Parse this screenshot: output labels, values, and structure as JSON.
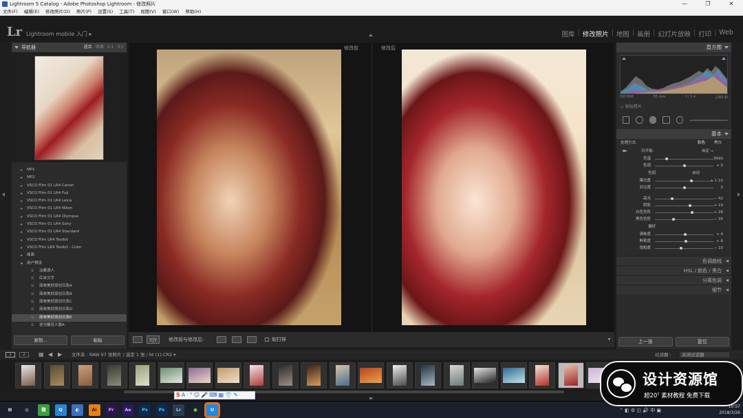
{
  "window": {
    "title": "Lightroom 5 Catalog - Adobe Photoshop Lightroom - 修改照片",
    "controls": [
      "—",
      "❐",
      "✕"
    ]
  },
  "menu": [
    "文件(F)",
    "编辑(E)",
    "修改照片(D)",
    "照片(P)",
    "设置(S)",
    "工具(T)",
    "视图(V)",
    "窗口(W)",
    "帮助(H)"
  ],
  "identity": {
    "logo": "Lr",
    "mobile": "Lightroom mobile 入门",
    "arrow": "▸"
  },
  "modules": [
    {
      "label": "图库",
      "active": false
    },
    {
      "label": "修改照片",
      "active": true
    },
    {
      "label": "地图",
      "active": false
    },
    {
      "label": "画册",
      "active": false
    },
    {
      "label": "幻灯片放映",
      "active": false
    },
    {
      "label": "打印",
      "active": false
    },
    {
      "label": "Web",
      "active": false
    }
  ],
  "navigator": {
    "title": "导航器",
    "options": [
      "适合",
      "填满",
      "1:1",
      "3:1"
    ]
  },
  "presets": [
    {
      "label": "MP1",
      "type": "folder"
    },
    {
      "label": "MP2",
      "type": "folder"
    },
    {
      "label": "VSCO Film 01 LR4 Canon",
      "type": "folder"
    },
    {
      "label": "VSCO Film 01 LR4 Fuji",
      "type": "folder"
    },
    {
      "label": "VSCO Film 01 LR4 Leica",
      "type": "folder"
    },
    {
      "label": "VSCO Film 01 LR4 Nikon",
      "type": "folder"
    },
    {
      "label": "VSCO Film 01 LR4 Olympus",
      "type": "folder"
    },
    {
      "label": "VSCO Film 01 LR4 Sony",
      "type": "folder"
    },
    {
      "label": "VSCO Film 01 LR4 Standard",
      "type": "folder"
    },
    {
      "label": "VSCO Film LR4 Toolkit",
      "type": "folder"
    },
    {
      "label": "VSCO Film LR4 Toolkit - Color",
      "type": "folder"
    },
    {
      "label": "画面",
      "type": "folder"
    },
    {
      "label": "用户预设",
      "type": "open"
    },
    {
      "label": "淡暴调人",
      "type": "sub"
    },
    {
      "label": "红米文字",
      "type": "sub"
    },
    {
      "label": "简单美好原创日系A",
      "type": "sub"
    },
    {
      "label": "简单美好原创日系B",
      "type": "sub"
    },
    {
      "label": "简单美好原创日系C",
      "type": "sub"
    },
    {
      "label": "简单美好原创日系D",
      "type": "sub"
    },
    {
      "label": "简单美好原创日系E",
      "type": "sub",
      "selected": true
    },
    {
      "label": "逆光糖没人像A",
      "type": "sub"
    }
  ],
  "left_buttons": [
    "复制...",
    "粘贴"
  ],
  "view": {
    "before": "修改前",
    "after": "修改后"
  },
  "toolbar": {
    "yy": "Y|Y",
    "compare_label": "修改前与修改后:",
    "softproof": "软打样"
  },
  "histogram": {
    "title": "直方图",
    "meta": [
      "ISO 800",
      "55 mm",
      "f / 1.4",
      "1/60 秒"
    ],
    "original": "原始照片"
  },
  "basic": {
    "title": "基本",
    "treatment_label": "处理方式:",
    "treatment_color": "彩色",
    "treatment_bw": "黑白",
    "wb_label": "白平衡:",
    "wb_value": "自定 ÷",
    "tone_label": "色调",
    "tone_auto": "自动",
    "presence_label": "偏好",
    "sliders_wb": [
      {
        "label": "色温",
        "value": "3690",
        "pos": 0.2
      },
      {
        "label": "色调",
        "value": "+ 0",
        "pos": 0.5
      }
    ],
    "sliders_tone1": [
      {
        "label": "曝光度",
        "value": "+ 1.10",
        "pos": 0.62
      },
      {
        "label": "对比度",
        "value": "0",
        "pos": 0.5
      }
    ],
    "sliders_tone2": [
      {
        "label": "高光",
        "value": "− 42",
        "pos": 0.29
      },
      {
        "label": "阴影",
        "value": "+ 19",
        "pos": 0.6
      },
      {
        "label": "白色色阶",
        "value": "+ 26",
        "pos": 0.63
      },
      {
        "label": "黑色色阶",
        "value": "− 35",
        "pos": 0.32
      }
    ],
    "sliders_presence": [
      {
        "label": "清晰度",
        "value": "+ 4",
        "pos": 0.52
      },
      {
        "label": "鲜艳度",
        "value": "+ 6",
        "pos": 0.53
      },
      {
        "label": "饱和度",
        "value": "− 10",
        "pos": 0.45
      }
    ]
  },
  "collapsed_panels": [
    "色调曲线",
    "HSL / 颜色 / 黑白",
    "分离色调",
    "细节"
  ],
  "right_buttons": [
    "上一张",
    "复位"
  ],
  "filmbar": {
    "pages": [
      "1",
      "2"
    ],
    "path": "文件夹 : RAW   97 张照片 / 选定 1 张 / bt (1).CR2 ▾",
    "filter_label": "过滤器 :",
    "filter_value": "关闭过滤器"
  },
  "filmstrip": [
    {
      "c1": "#e8e8e8",
      "c2": "#7d5a4a",
      "shape": "portrait"
    },
    {
      "c1": "#5b4a35",
      "c2": "#a58c5c",
      "shape": "portrait"
    },
    {
      "c1": "#c9a07a",
      "c2": "#8a5d3f",
      "shape": "portrait"
    },
    {
      "c1": "#3a3a32",
      "c2": "#8b8b7a",
      "shape": "portrait"
    },
    {
      "c1": "#9aa17d",
      "c2": "#dde2c9",
      "shape": "portrait"
    },
    {
      "c1": "#6b8f6f",
      "c2": "#dfe8e1",
      "shape": "landscape"
    },
    {
      "c1": "#8d6b9a",
      "c2": "#efd7c5",
      "shape": "landscape"
    },
    {
      "c1": "#c39a6d",
      "c2": "#f2e1c6",
      "shape": "landscape"
    },
    {
      "c1": "#f0e7e0",
      "c2": "#b33a3f",
      "shape": "portrait"
    },
    {
      "c1": "#2a2a2a",
      "c2": "#9d8f84",
      "shape": "portrait"
    },
    {
      "c1": "#3a2217",
      "c2": "#d69b5e",
      "shape": "portrait"
    },
    {
      "c1": "#d6c4a8",
      "c2": "#4b6e8c",
      "shape": "portrait"
    },
    {
      "c1": "#b3461e",
      "c2": "#f0a04b",
      "shape": "landscape"
    },
    {
      "c1": "#eeeeee",
      "c2": "#4a4a4a",
      "shape": "portrait"
    },
    {
      "c1": "#28323d",
      "c2": "#a5b7c9",
      "shape": "portrait"
    },
    {
      "c1": "#d9d9d0",
      "c2": "#6a7a7a",
      "shape": "portrait"
    },
    {
      "c1": "#e5e5e5",
      "c2": "#222222",
      "shape": "landscape"
    },
    {
      "c1": "#2f6a8f",
      "c2": "#c2e3ef",
      "shape": "landscape"
    },
    {
      "c1": "#efe6d6",
      "c2": "#b82d2e",
      "shape": "portrait"
    },
    {
      "c1": "#e4c2a8",
      "c2": "#9b2225",
      "shape": "portrait",
      "selected": true
    },
    {
      "c1": "#c9b4d9",
      "c2": "#f2e7f0",
      "shape": "landscape"
    }
  ],
  "ime": [
    "S",
    "A",
    "·",
    "°",
    "☺",
    "🎤",
    "⌨",
    "▦",
    "👕",
    "✎"
  ],
  "taskbar": [
    {
      "label": "⊞",
      "bg": "#1a1f2b",
      "fg": "#ffffff"
    },
    {
      "label": "◎",
      "bg": "#1a1f2b",
      "fg": "#dddddd"
    },
    {
      "label": "微",
      "bg": "#38a13b",
      "fg": "#ffffff"
    },
    {
      "label": "Q",
      "bg": "#2a84d1",
      "fg": "#ffffff"
    },
    {
      "label": "◐",
      "bg": "#3d6fbf",
      "fg": "#ffffff"
    },
    {
      "label": "Ai",
      "bg": "#e48413",
      "fg": "#2e1500"
    },
    {
      "label": "Pr",
      "bg": "#2d1449",
      "fg": "#d6a5ff"
    },
    {
      "label": "Ae",
      "bg": "#2b1a5c",
      "fg": "#cdb4ff"
    },
    {
      "label": "Ps",
      "bg": "#0f2a4d",
      "fg": "#3fc6ff"
    },
    {
      "label": "Ps",
      "bg": "#0f2a4d",
      "fg": "#3fc6ff"
    },
    {
      "label": "Lr",
      "bg": "#2b3a4f",
      "fg": "#a7cbf1"
    },
    {
      "label": "●",
      "bg": "#1a1f2b",
      "fg": "#6fbf3a"
    },
    {
      "label": "U",
      "bg": "#1f8ae0",
      "fg": "#ffffff"
    }
  ],
  "tray": {
    "time": "10:57",
    "date": "2018/3/26"
  },
  "watermark": {
    "title": "设计资源馆",
    "subtitle": "超20ᵀ 素材教程 免费下载"
  }
}
